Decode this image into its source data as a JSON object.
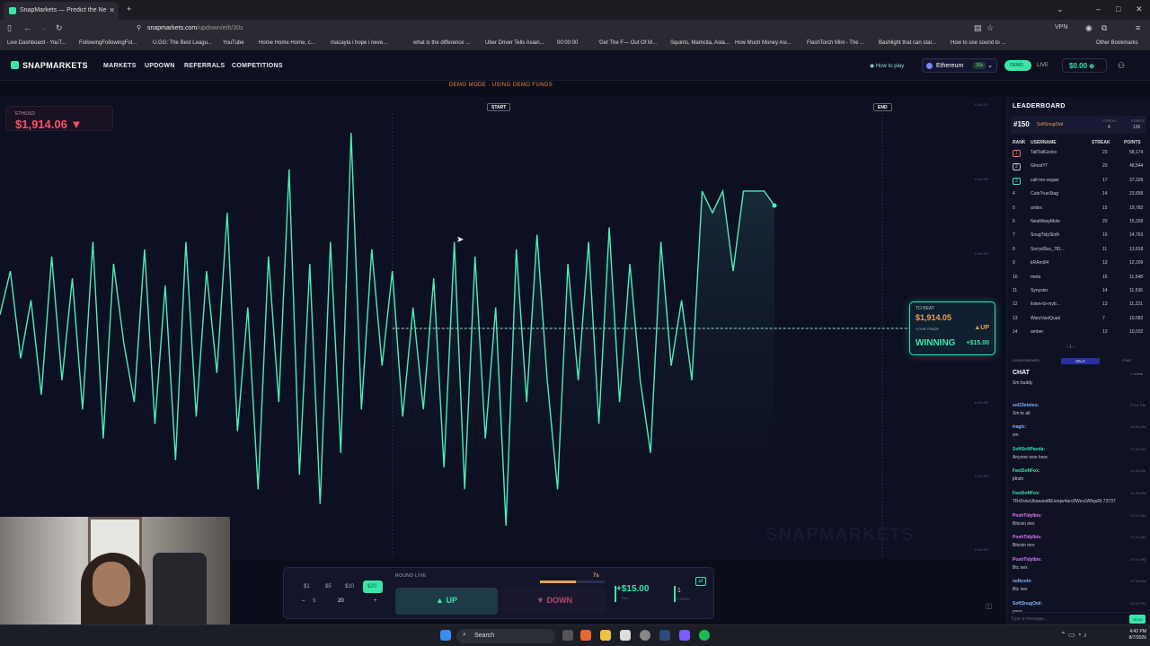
{
  "browser": {
    "tab_title": "SnapMarkets — Predict the Ne",
    "url_main": "snapmarkets.com",
    "url_path": "/updown/eth/30s",
    "vpn": "VPN",
    "bookmarks": [
      "Live Dashboard - YouT...",
      "FollowingFollowingFol...",
      "U.GG: The Best Leagu...",
      "YouTube",
      "Home Home Home, c...",
      "macayla i hope i neve...",
      "what is the difference ...",
      "Uber Driver Tells Asian...",
      "00:00:00",
      "'Get The F— Out Of M...",
      "Squints, Mamcita, Asia...",
      "How Much Money Asi...",
      "FlashTorch Mini - The ...",
      "Bashlight that can star...",
      "How to use sound to ...",
      "Other Bookmarks"
    ]
  },
  "header": {
    "logo": "SNAPMARKETS",
    "nav": [
      "MARKETS",
      "UPDOWN",
      "REFERRALS",
      "COMPETITIONS"
    ],
    "how_to_play": "How to play",
    "asset": "Ethereum",
    "asset_badge": "30s",
    "toggle": "DEMO",
    "live": "LIVE",
    "balance": "$0.00"
  },
  "banner": "DEMO MODE · USING DEMO FUNDS",
  "price": {
    "symbol": "ETH/USD",
    "value": "$1,914.06 ▼"
  },
  "markers": {
    "start": "START",
    "end": "END"
  },
  "beat": {
    "label": "TO BEAT",
    "value": "$1,914.05",
    "your_trade": "YOUR TRADE",
    "direction": "▲UP",
    "status": "WINNING",
    "gain": "+$15.00"
  },
  "yticks": [
    "1,914.07",
    "1,914.06",
    "1,914.06",
    "1,914.06",
    "1,914.06",
    "1,914.06",
    "1,914.06",
    "1,914.05"
  ],
  "watermark": "SNAPMARKETS",
  "chart_data": {
    "type": "line",
    "series": [
      {
        "values": [
          1914.0569,
          1914.0575,
          1914.0563,
          1914.0571,
          1914.0558,
          1914.0577,
          1914.056,
          1914.0574,
          1914.0556,
          1914.0579,
          1914.0552,
          1914.0576,
          1914.0565,
          1914.0557,
          1914.0578,
          1914.0554,
          1914.0573,
          1914.0549,
          1914.0579,
          1914.0555,
          1914.0575,
          1914.0561,
          1914.0583,
          1914.0553,
          1914.057,
          1914.0545,
          1914.0577,
          1914.0557,
          1914.0589,
          1914.0547,
          1914.0576,
          1914.0543,
          1914.0579,
          1914.055,
          1914.0594,
          1914.0556,
          1914.0578,
          1914.0562,
          1914.0575,
          1914.0555,
          1914.057,
          1914.0556,
          1914.0574,
          1914.0548,
          1914.0579,
          1914.0545,
          1914.0577,
          1914.0552,
          1914.057,
          1914.054,
          1914.0578,
          1914.0557,
          1914.058,
          1914.056,
          1914.0545,
          1914.0576,
          1914.056,
          1914.0579,
          1914.0554,
          1914.0581,
          1914.0557,
          1914.0576,
          1914.056,
          1914.055,
          1914.0579,
          1914.0562,
          1914.0571,
          1914.056,
          1914.0586,
          1914.0583,
          1914.0586,
          1914.0575,
          1914.0586,
          1914.0586,
          1914.0586,
          1914.0584
        ]
      }
    ],
    "start_index": 38,
    "end_index": 75
  },
  "trade": {
    "amounts": [
      "$1",
      "$5",
      "$10",
      "$20"
    ],
    "minus": "–",
    "currency": "$",
    "amount_value": "20",
    "plus": "+",
    "round_live": "ROUND LIVE",
    "timer": "7s",
    "time_fraction": 0.55,
    "up": "▲ UP",
    "down": "▼ DOWN",
    "pnl": "+$15.00",
    "pnl_label": "P&L",
    "streak": "1",
    "streak_label": "STREAK",
    "share_icon": "⇄"
  },
  "leaderboard": {
    "title": "LEADERBOARD",
    "me": {
      "rank": "#150",
      "name": "SoftSnugOwl",
      "streak_label": "STREAK",
      "streak": "4",
      "points_label": "POINTS",
      "points": "135"
    },
    "headers": [
      "RANK",
      "USERNAME",
      "STREAK",
      "POINTS"
    ],
    "rows": [
      {
        "rank": "1",
        "name": "TallTallGecko",
        "streak": "23",
        "points": "58,174"
      },
      {
        "rank": "2",
        "name": "Ghost!!7",
        "streak": "20",
        "points": "48,544"
      },
      {
        "rank": "3",
        "name": "call-me-vegan",
        "streak": "17",
        "points": "37,329"
      },
      {
        "rank": "4",
        "name": "CuteTrueStag",
        "streak": "14",
        "points": "23,658"
      },
      {
        "rank": "5",
        "name": "antixx",
        "streak": "15",
        "points": "19,782"
      },
      {
        "rank": "6",
        "name": "NeatWaryMole",
        "streak": "20",
        "points": "15,339"
      },
      {
        "rank": "7",
        "name": "SnugTidySloth",
        "streak": "10",
        "points": "14,763"
      },
      {
        "rank": "8",
        "name": "SorrydSss_781...",
        "streak": "11",
        "points": "13,818"
      },
      {
        "rank": "9",
        "name": "kRAmi04",
        "streak": "13",
        "points": "12,209"
      },
      {
        "rank": "10",
        "name": "meta",
        "streak": "16",
        "points": "11,548"
      },
      {
        "rank": "11",
        "name": "Synyster",
        "streak": "14",
        "points": "11,536"
      },
      {
        "rank": "12",
        "name": "listen-to-myb...",
        "streak": "13",
        "points": "11,221"
      },
      {
        "rank": "13",
        "name": "WaryVastQuail",
        "streak": "7",
        "points": "10,082"
      },
      {
        "rank": "14",
        "name": "amber",
        "streak": "13",
        "points": "10,032"
      }
    ],
    "pager": "‹ 1 ›",
    "tabs": [
      "LEADERBOARD",
      "SPLIT",
      "CHAT"
    ]
  },
  "chat": {
    "title": "CHAT",
    "online": "1 online",
    "messages": [
      {
        "user": "",
        "text": "Sm buddy",
        "time": "",
        "color": "#7fb8ff"
      },
      {
        "user": "sol23stetsu:",
        "text": "Sm to all",
        "time": "07:01 PM",
        "color": "#7fb8ff"
      },
      {
        "user": "tragic:",
        "text": "sm",
        "time": "02:51 AM",
        "color": "#7fb8ff"
      },
      {
        "user": "SoftSoftPanda:",
        "text": "Anyone won here",
        "time": "07:26 AM",
        "color": "#39e6a8"
      },
      {
        "user": "FastSoftFox:",
        "text": "jdndn",
        "time": "11:45 AM",
        "color": "#39e6a8"
      },
      {
        "user": "FastSoftFox:",
        "text": "TRx5vkxUbasand8Ennqw4arc8Wev2A8quRt 73737",
        "time": "11:45 AM",
        "color": "#39e6a8"
      },
      {
        "user": "PoshTidyIbis:",
        "text": "Bitcoin nex",
        "time": "07:37 AM",
        "color": "#e07bff"
      },
      {
        "user": "PoshTidyIbis:",
        "text": "Bitcoin nex",
        "time": "07:37 AM",
        "color": "#e07bff"
      },
      {
        "user": "PoshTidyIbis:",
        "text": "Btc nex",
        "time": "07:41 PM",
        "color": "#e07bff"
      },
      {
        "user": "solkcoin:",
        "text": "Btc nex",
        "time": "07:43 AM",
        "color": "#7fb8ff"
      },
      {
        "user": "SoftSnugOwl:",
        "text": "yooo",
        "time": "04:11 PM",
        "color": "#7fb8ff"
      }
    ],
    "placeholder": "Type a message...",
    "send": "SEND"
  },
  "taskbar": {
    "search": "Search",
    "time": "4:42 PM",
    "date": "8/7/2026"
  }
}
